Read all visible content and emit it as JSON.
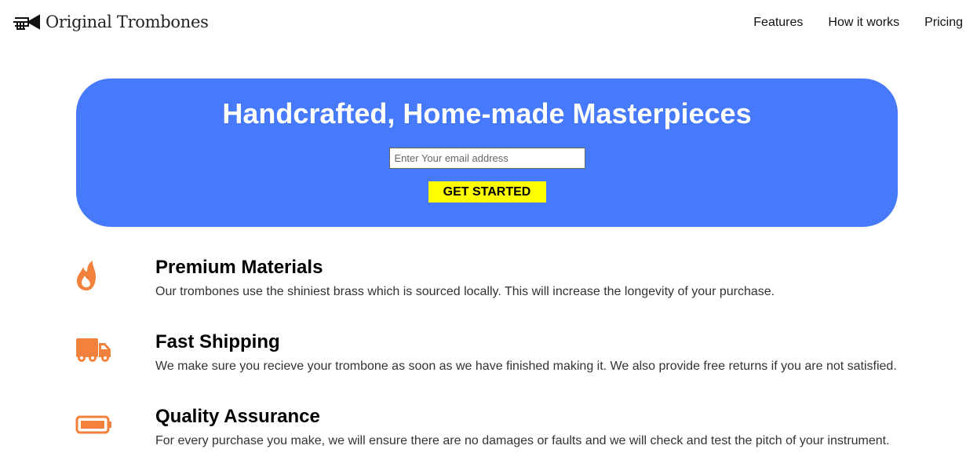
{
  "brand": {
    "name": "Original Trombones",
    "logo_icon": "trombone-icon"
  },
  "nav": {
    "items": [
      {
        "label": "Features"
      },
      {
        "label": "How it works"
      },
      {
        "label": "Pricing"
      }
    ]
  },
  "hero": {
    "title": "Handcrafted, Home-made Masterpieces",
    "email_placeholder": "Enter Your email address",
    "email_value": "",
    "cta_label": "GET STARTED",
    "background_color": "#4779fb",
    "cta_color": "#ffff00"
  },
  "features": [
    {
      "icon": "fire-icon",
      "title": "Premium Materials",
      "description": "Our trombones use the shiniest brass which is sourced locally. This will increase the longevity of your purchase."
    },
    {
      "icon": "truck-icon",
      "title": "Fast Shipping",
      "description": "We make sure you recieve your trombone as soon as we have finished making it. We also provide free returns if you are not satisfied."
    },
    {
      "icon": "battery-icon",
      "title": "Quality Assurance",
      "description": "For every purchase you make, we will ensure there are no damages or faults and we will check and test the pitch of your instrument."
    }
  ],
  "icon_color": "#f1813c"
}
